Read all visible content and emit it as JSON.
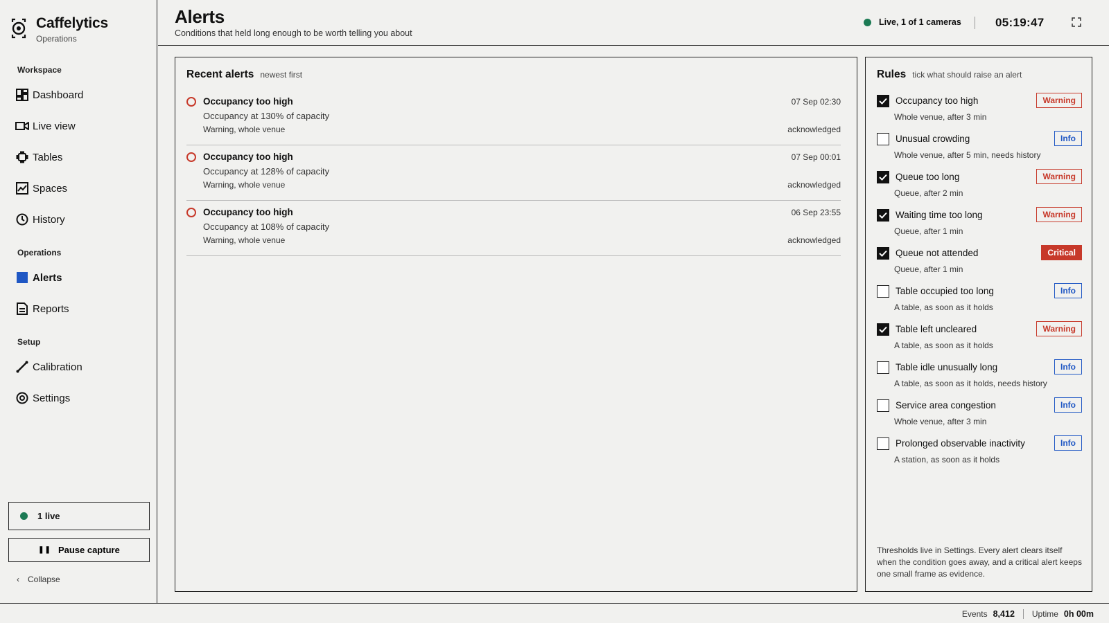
{
  "brand": {
    "name": "Caffelytics",
    "subtitle": "Operations"
  },
  "nav": {
    "workspace_label": "Workspace",
    "operations_label": "Operations",
    "setup_label": "Setup",
    "items": [
      {
        "label": "Dashboard",
        "icon": "dashboard-icon"
      },
      {
        "label": "Live view",
        "icon": "video-camera-icon"
      },
      {
        "label": "Tables",
        "icon": "table-icon"
      },
      {
        "label": "Spaces",
        "icon": "area-chart-icon"
      },
      {
        "label": "History",
        "icon": "clock-icon"
      },
      {
        "label": "Alerts",
        "icon": "alert-square-icon",
        "active": true
      },
      {
        "label": "Reports",
        "icon": "document-icon"
      },
      {
        "label": "Calibration",
        "icon": "ruler-icon"
      },
      {
        "label": "Settings",
        "icon": "settings-icon"
      }
    ]
  },
  "sidebar_footer": {
    "live_label": "1 live",
    "pause_label": "Pause capture",
    "collapse_label": "Collapse"
  },
  "header": {
    "title": "Alerts",
    "subtitle": "Conditions that held long enough to be worth telling you about",
    "live_status": "Live, 1 of 1 cameras",
    "clock": "05:19:47"
  },
  "alerts": {
    "title": "Recent alerts",
    "hint": "newest first",
    "items": [
      {
        "title": "Occupancy too high",
        "detail": "Occupancy at 130% of capacity",
        "meta": "Warning, whole venue",
        "time": "07 Sep 02:30",
        "status": "acknowledged"
      },
      {
        "title": "Occupancy too high",
        "detail": "Occupancy at 128% of capacity",
        "meta": "Warning, whole venue",
        "time": "07 Sep 00:01",
        "status": "acknowledged"
      },
      {
        "title": "Occupancy too high",
        "detail": "Occupancy at 108% of capacity",
        "meta": "Warning, whole venue",
        "time": "06 Sep 23:55",
        "status": "acknowledged"
      }
    ]
  },
  "rules": {
    "title": "Rules",
    "hint": "tick what should raise an alert",
    "items": [
      {
        "name": "Occupancy too high",
        "scope": "Whole venue, after 3 min",
        "severity": "Warning",
        "checked": true
      },
      {
        "name": "Unusual crowding",
        "scope": "Whole venue, after 5 min, needs history",
        "severity": "Info",
        "checked": false
      },
      {
        "name": "Queue too long",
        "scope": "Queue, after 2 min",
        "severity": "Warning",
        "checked": true
      },
      {
        "name": "Waiting time too long",
        "scope": "Queue, after 1 min",
        "severity": "Warning",
        "checked": true
      },
      {
        "name": "Queue not attended",
        "scope": "Queue, after 1 min",
        "severity": "Critical",
        "checked": true
      },
      {
        "name": "Table occupied too long",
        "scope": "A table, as soon as it holds",
        "severity": "Info",
        "checked": false
      },
      {
        "name": "Table left uncleared",
        "scope": "A table, as soon as it holds",
        "severity": "Warning",
        "checked": true
      },
      {
        "name": "Table idle unusually long",
        "scope": "A table, as soon as it holds, needs history",
        "severity": "Info",
        "checked": false
      },
      {
        "name": "Service area congestion",
        "scope": "Whole venue, after 3 min",
        "severity": "Info",
        "checked": false
      },
      {
        "name": "Prolonged observable inactivity",
        "scope": "A station, as soon as it holds",
        "severity": "Info",
        "checked": false
      }
    ],
    "footnote": "Thresholds live in Settings. Every alert clears itself when the condition goes away, and a critical alert keeps one small frame as evidence."
  },
  "footer": {
    "events_label": "Events",
    "events_value": "8,412",
    "uptime_label": "Uptime",
    "uptime_value": "0h 00m"
  },
  "colors": {
    "live": "#1c7a54",
    "warning": "#c7392a",
    "info": "#1f57c4",
    "critical": "#c7392a",
    "accent": "#1f57c4"
  }
}
